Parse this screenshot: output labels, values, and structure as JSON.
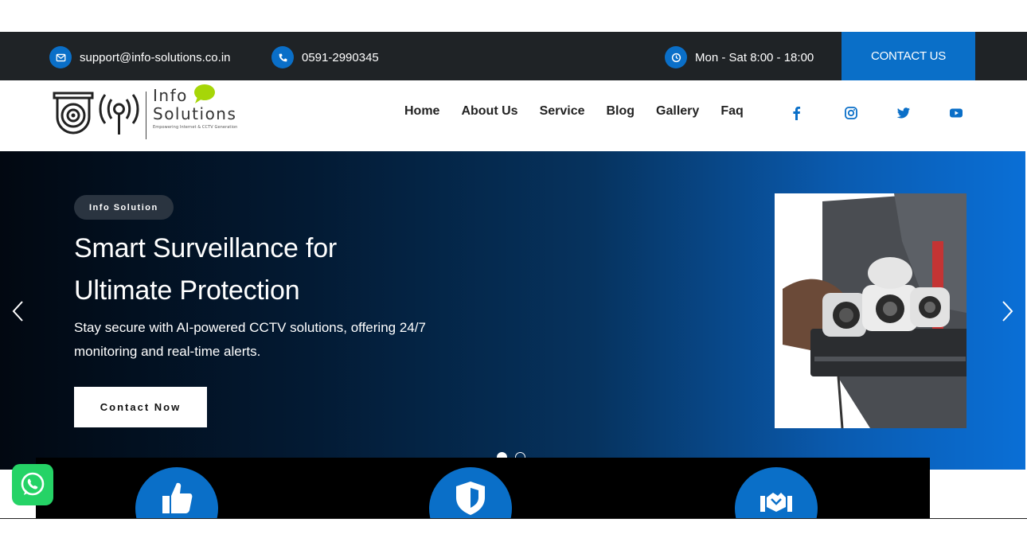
{
  "topbar": {
    "email": "support@info-solutions.co.in",
    "phone": "0591-2990345",
    "hours": "Mon - Sat 8:00 - 18:00",
    "contact_label": "CONTACT US",
    "icons": [
      "mail-icon",
      "phone-icon",
      "clock-icon"
    ]
  },
  "logo": {
    "line1": "Info",
    "line2": "Solutions",
    "tagline": "Empowering Internet & CCTV Generation"
  },
  "nav": {
    "items": [
      {
        "label": "Home"
      },
      {
        "label": "About Us"
      },
      {
        "label": "Service"
      },
      {
        "label": "Blog"
      },
      {
        "label": "Gallery"
      },
      {
        "label": "Faq"
      }
    ]
  },
  "social": [
    "facebook-icon",
    "instagram-icon",
    "twitter-icon",
    "youtube-icon"
  ],
  "hero": {
    "badge": "Info Solution",
    "headline_line1": "Smart Surveillance for",
    "headline_line2": "Ultimate Protection",
    "subtext": "Stay secure with AI-powered CCTV solutions, offering 24/7 monitoring and real-time alerts.",
    "cta_label": "Contact Now",
    "slides_total": 2,
    "slide_active": 1
  },
  "features": [
    "thumbs-up-icon",
    "shield-icon",
    "handshake-icon"
  ],
  "colors": {
    "brand_blue": "#0a6fc8",
    "topbar_bg": "#1f2326",
    "whatsapp_green": "#25d366"
  }
}
